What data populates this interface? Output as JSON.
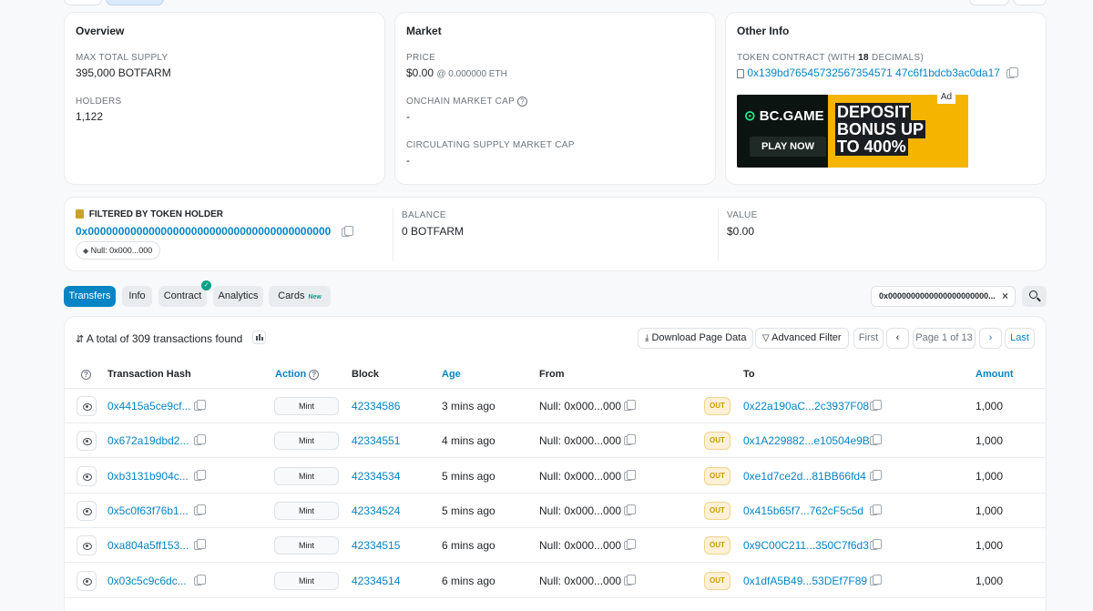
{
  "overview": {
    "title": "Overview",
    "max_supply_label": "MAX TOTAL SUPPLY",
    "max_supply_value": "395,000 BOTFARM",
    "holders_label": "HOLDERS",
    "holders_value": "1,122"
  },
  "market": {
    "title": "Market",
    "price_label": "PRICE",
    "price_value": "$0.00",
    "price_eth": "@ 0.000000 ETH",
    "onchain_cap_label": "ONCHAIN MARKET CAP",
    "onchain_cap_value": "-",
    "circ_cap_label": "CIRCULATING SUPPLY MARKET CAP",
    "circ_cap_value": "-"
  },
  "other_info": {
    "title": "Other Info",
    "contract_label_prefix": "TOKEN CONTRACT (WITH ",
    "contract_decimals": "18",
    "contract_label_suffix": " DECIMALS)",
    "contract_address": "0x139bd76545732567354571 47c6f1bdcb3ac0da17",
    "ad": {
      "brand": "BC.GAME",
      "cta": "PLAY NOW",
      "line1": "DEPOSIT",
      "line2": "BONUS UP",
      "line3": "TO 400%",
      "badge": "Ad"
    }
  },
  "filter": {
    "label": "FILTERED BY TOKEN HOLDER",
    "address": "0x0000000000000000000000000000000000000000",
    "tag": "Null: 0x000...000",
    "balance_label": "BALANCE",
    "balance_value": "0 BOTFARM",
    "value_label": "VALUE",
    "value_value": "$0.00"
  },
  "tabs": [
    {
      "label": "Transfers"
    },
    {
      "label": "Info"
    },
    {
      "label": "Contract"
    },
    {
      "label": "Analytics"
    },
    {
      "label": "Cards",
      "badge": "New"
    }
  ],
  "address_filter": "0x0000000000000000000000...",
  "transfers": {
    "summary": "A total of 309 transactions found",
    "download": "Download Page Data",
    "advanced_filter": "Advanced Filter",
    "first": "First",
    "page": "Page 1 of 13",
    "last": "Last",
    "headers": {
      "tx_hash": "Transaction Hash",
      "action": "Action",
      "block": "Block",
      "age": "Age",
      "from": "From",
      "to": "To",
      "amount": "Amount"
    },
    "rows": [
      {
        "hash": "0x4415a5ce9cf...",
        "method": "Mint",
        "block": "42334586",
        "age": "3 mins ago",
        "from": "Null: 0x000...000",
        "dir": "OUT",
        "to": "0x22a190aC...2c3937F08",
        "amount": "1,000"
      },
      {
        "hash": "0x672a19dbd2...",
        "method": "Mint",
        "block": "42334551",
        "age": "4 mins ago",
        "from": "Null: 0x000...000",
        "dir": "OUT",
        "to": "0x1A229882...e10504e9B",
        "amount": "1,000"
      },
      {
        "hash": "0xb3131b904c...",
        "method": "Mint",
        "block": "42334534",
        "age": "5 mins ago",
        "from": "Null: 0x000...000",
        "dir": "OUT",
        "to": "0xe1d7ce2d...81BB66fd4",
        "amount": "1,000"
      },
      {
        "hash": "0x5c0f63f76b1...",
        "method": "Mint",
        "block": "42334524",
        "age": "5 mins ago",
        "from": "Null: 0x000...000",
        "dir": "OUT",
        "to": "0x415b65f7...762cF5c5d",
        "amount": "1,000"
      },
      {
        "hash": "0xa804a5ff153...",
        "method": "Mint",
        "block": "42334515",
        "age": "6 mins ago",
        "from": "Null: 0x000...000",
        "dir": "OUT",
        "to": "0x9C00C211...350C7f6d3",
        "amount": "1,000"
      },
      {
        "hash": "0x03c5c9c6dc...",
        "method": "Mint",
        "block": "42334514",
        "age": "6 mins ago",
        "from": "Null: 0x000...000",
        "dir": "OUT",
        "to": "0x1dfA5B49...53DEf7F89",
        "amount": "1,000"
      }
    ]
  }
}
